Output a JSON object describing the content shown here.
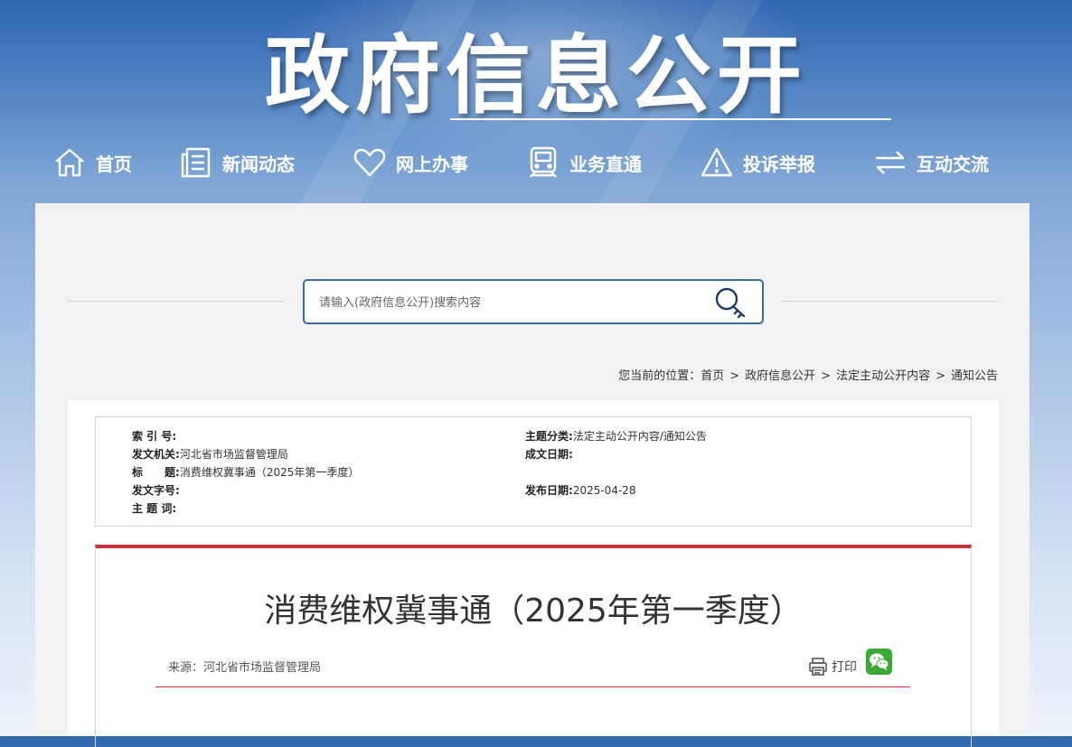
{
  "header": {
    "title": "政府信息公开"
  },
  "nav": [
    {
      "label": "首页",
      "icon": "home-icon"
    },
    {
      "label": "新闻动态",
      "icon": "news-icon"
    },
    {
      "label": "网上办事",
      "icon": "heart-icon"
    },
    {
      "label": "业务直通",
      "icon": "train-icon"
    },
    {
      "label": "投诉举报",
      "icon": "warning-icon"
    },
    {
      "label": "互动交流",
      "icon": "exchange-icon"
    }
  ],
  "search": {
    "placeholder": "请输入(政府信息公开)搜索内容"
  },
  "breadcrumb": {
    "prefix": "您当前的位置：",
    "items": [
      "首页",
      "政府信息公开",
      "法定主动公开内容",
      "通知公告"
    ],
    "separator": ">"
  },
  "meta": {
    "index_label": "索 引 号:",
    "index_value": "",
    "issuer_label": "发文机关:",
    "issuer_value": "河北省市场监督管理局",
    "title_label": "标　　题:",
    "title_value": "消费维权冀事通（2025年第一季度）",
    "doc_no_label": "发文字号:",
    "doc_no_value": "",
    "keywords_label": "主 题 词:",
    "keywords_value": "",
    "category_label": "主题分类:",
    "category_value": "法定主动公开内容/通知公告",
    "created_label": "成文日期:",
    "created_value": "",
    "published_label": "发布日期:",
    "published_value": "2025-04-28"
  },
  "article": {
    "title": "消费维权冀事通（2025年第一季度）",
    "source_label": "来源：",
    "source_value": "河北省市场监督管理局",
    "print_label": "打印"
  },
  "colors": {
    "accent_red": "#c5323a",
    "search_border": "#3a6aa8",
    "wechat_green": "#3aa935"
  }
}
